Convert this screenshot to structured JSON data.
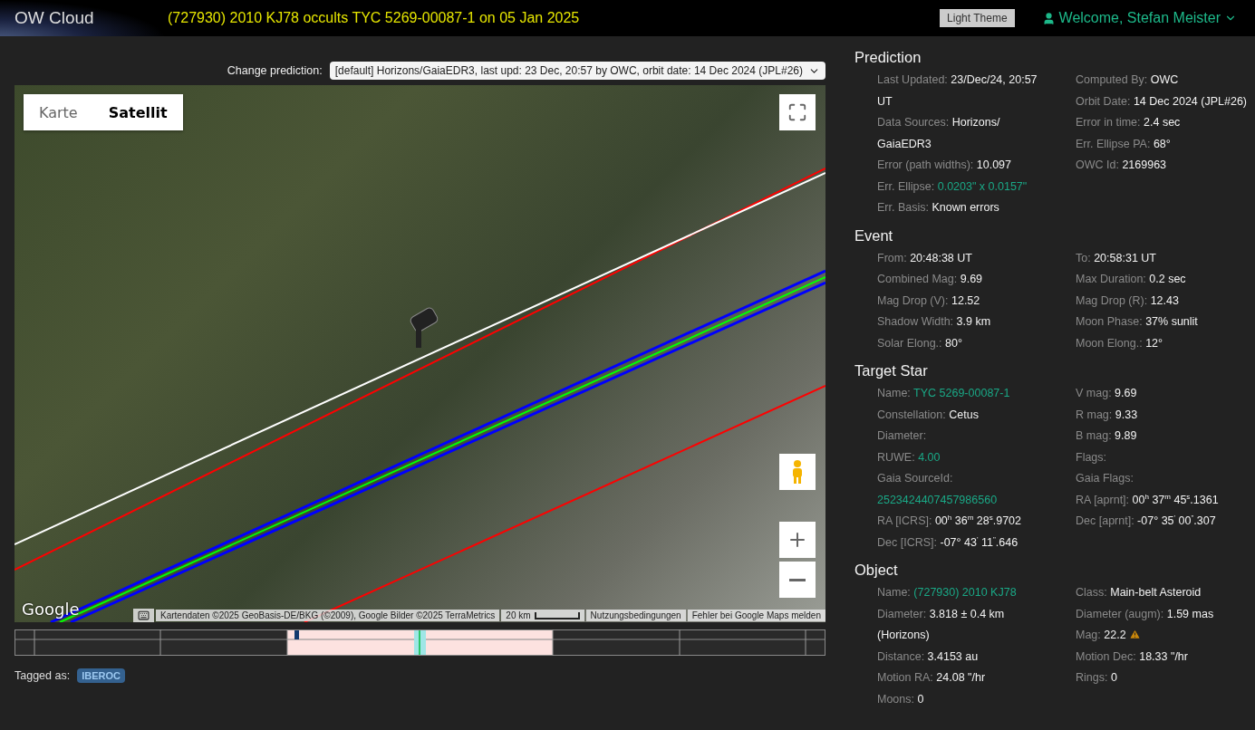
{
  "header": {
    "brand": "OW Cloud",
    "title": "(727930) 2010 KJ78 occults TYC 5269-00087-1 on 05 Jan 2025",
    "theme_button": "Light Theme",
    "user": "Welcome, Stefan Meister"
  },
  "prediction_select": {
    "label": "Change prediction:",
    "value": "[default] Horizons/GaiaEDR3, last upd: 23 Dec, 20:57 by OWC, orbit date: 14 Dec 2024 (JPL#26)"
  },
  "map": {
    "map_types": [
      {
        "label": "Karte",
        "selected": false
      },
      {
        "label": "Satellit",
        "selected": true
      }
    ],
    "logo": "Google",
    "attribution": [
      "Kartendaten ©2025 GeoBasis-DE/BKG (©2009), Google Bilder ©2025 TerraMetrics",
      "20 km",
      "Nutzungsbedingungen",
      "Fehler bei Google Maps melden"
    ]
  },
  "tags": {
    "label": "Tagged as:",
    "items": [
      "IBEROC"
    ]
  },
  "sections": [
    {
      "title": "Prediction",
      "left": [
        {
          "label": "Last Updated:",
          "value": "23/Dec/24, 20:57 UT"
        },
        {
          "label": "Data Sources:",
          "value": "Horizons/ GaiaEDR3"
        },
        {
          "label": "Error (path widths):",
          "value": "10.097"
        },
        {
          "label": "Err. Ellipse:",
          "value": "0.0203\" x 0.0157\"",
          "kind": "link"
        },
        {
          "label": "Err. Basis:",
          "value": "Known errors"
        }
      ],
      "right": [
        {
          "label": "Computed By:",
          "value": "OWC"
        },
        {
          "label": "Orbit Date:",
          "value": "14 Dec 2024 (JPL#26)"
        },
        {
          "label": "Error in time:",
          "value": "2.4 sec"
        },
        {
          "label": "Err. Ellipse PA:",
          "value": "68°"
        },
        {
          "label": "OWC Id:",
          "value": "2169963"
        }
      ]
    },
    {
      "title": "Event",
      "left": [
        {
          "label": "From:",
          "value": "20:48:38 UT"
        },
        {
          "label": "Combined Mag:",
          "value": "9.69"
        },
        {
          "label": "Mag Drop (V):",
          "value": "12.52"
        },
        {
          "label": "Shadow Width:",
          "value": "3.9 km"
        },
        {
          "label": "Solar Elong.:",
          "value": "80°"
        }
      ],
      "right": [
        {
          "label": "To:",
          "value": "20:58:31 UT"
        },
        {
          "label": "Max Duration:",
          "value": "0.2 sec"
        },
        {
          "label": "Mag Drop (R):",
          "value": "12.43"
        },
        {
          "label": "Moon Phase:",
          "value": "37% sunlit"
        },
        {
          "label": "Moon Elong.:",
          "value": "12°"
        }
      ]
    },
    {
      "title": "Target Star",
      "left": [
        {
          "label": "Name:",
          "value": "TYC 5269-00087-1",
          "kind": "link"
        },
        {
          "label": "Constellation:",
          "value": "Cetus"
        },
        {
          "label": "Diameter:"
        },
        {
          "label": "RUWE:",
          "value": "4.00",
          "kind": "link"
        },
        {
          "label": "Gaia SourceId:",
          "value": "2523424407457986560",
          "kind": "link"
        },
        {
          "label": "RA [ICRS]:",
          "value": "00$^{h}$ 36$^{m}$ 28$^{s}$.9702"
        },
        {
          "label": "Dec [ICRS]:",
          "value": "-07° 43$^{'}$ 11$^{\"}$.646"
        }
      ],
      "right": [
        {
          "label": "V mag:",
          "value": "9.69"
        },
        {
          "label": "R mag:",
          "value": "9.33"
        },
        {
          "label": "B mag:",
          "value": "9.89"
        },
        {
          "label": "Flags:"
        },
        {
          "label": "Gaia Flags:"
        },
        {
          "label": "RA [aprnt]:",
          "value": "00$^{h}$ 37$^{m}$ 45$^{s}$.1361"
        },
        {
          "label": "Dec [aprnt]:",
          "value": "-07° 35$^{'}$ 00$^{\"}$.307"
        }
      ]
    },
    {
      "title": "Object",
      "left": [
        {
          "label": "Name:",
          "value": "(727930) 2010 KJ78",
          "kind": "link"
        },
        {
          "label": "Diameter:",
          "value": "3.818 ± 0.4 km (Horizons)"
        },
        {
          "label": "Distance:",
          "value": "3.4153 au"
        },
        {
          "label": "Motion RA:",
          "value": "24.08 \"/hr"
        },
        {
          "label": "Moons:",
          "value": "0"
        }
      ],
      "right": [
        {
          "label": "Class:",
          "value": "Main-belt Asteroid"
        },
        {
          "label": "Diameter (augm):",
          "value": "1.59 mas"
        },
        {
          "label": "Mag:",
          "value": "22.2",
          "warning": true
        },
        {
          "label": "Motion Dec:",
          "value": "18.33 \"/hr"
        },
        {
          "label": "Rings:",
          "value": "0"
        }
      ]
    }
  ]
}
